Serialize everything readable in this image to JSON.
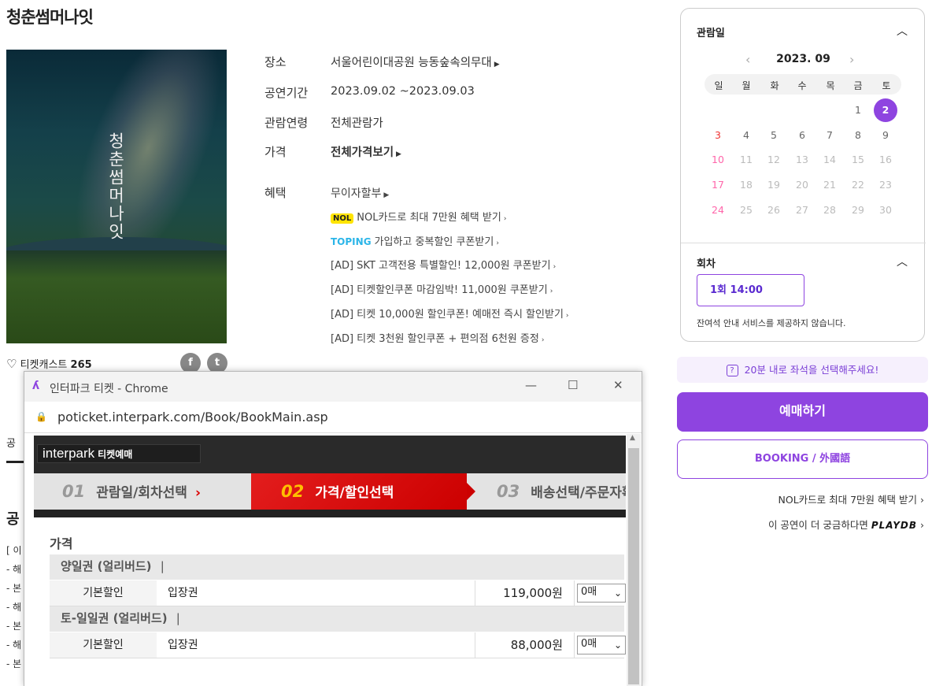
{
  "show": {
    "title": "청춘썸머나잇",
    "poster_text": "청춘썸머나잇"
  },
  "info": {
    "venue_label": "장소",
    "venue": "서울어린이대공원 능동숲속의무대",
    "period_label": "공연기간",
    "period": "2023.09.02 ~2023.09.03",
    "age_label": "관람연령",
    "age": "전체관람가",
    "price_label": "가격",
    "price": "전체가격보기",
    "benefit_label": "혜택"
  },
  "benefits": [
    "무이자할부",
    "NOL카드로 최대 7만원 혜택 받기",
    "가입하고 중복할인 쿠폰받기",
    "[AD] SKT 고객전용 특별할인! 12,000원 쿠폰받기",
    "[AD] 티켓할인쿠폰 마감임박! 11,000원 쿠폰받기",
    "[AD] 티켓 10,000원 할인쿠폰! 예매전 즉시 할인받기",
    "[AD] 티켓 3천원 할인쿠폰 + 편의점 6천원 증정"
  ],
  "badges": {
    "nol": "NOL",
    "toping": "TOPING"
  },
  "fav": {
    "label": "티켓캐스트",
    "count": "265"
  },
  "social": {
    "facebook": "f",
    "twitter": "t"
  },
  "calendar": {
    "heading": "관람일",
    "month": "2023. 09",
    "weekdays": [
      "일",
      "월",
      "화",
      "수",
      "목",
      "금",
      "토"
    ],
    "days": [
      "1",
      "2",
      "3",
      "4",
      "5",
      "6",
      "7",
      "8",
      "9",
      "10",
      "11",
      "12",
      "13",
      "14",
      "15",
      "16",
      "17",
      "18",
      "19",
      "20",
      "21",
      "22",
      "23",
      "24",
      "25",
      "26",
      "27",
      "28",
      "29",
      "30"
    ],
    "selected_day": "2"
  },
  "session": {
    "heading": "회차",
    "option": "1회 14:00",
    "notice": "잔여석 안내 서비스를 제공하지 않습니다."
  },
  "timer_notice": "20분 내로 좌석을 선택해주세요!",
  "reserve_button": "예매하기",
  "booking_button": "BOOKING / 外國語",
  "nol_link": "NOL카드로 최대 7만원 혜택 받기",
  "curious_link": "이 공연이 더 궁금하다면",
  "playdb": "PLAYDB",
  "background": {
    "tab_fragment": "공",
    "intro_fragment": "공",
    "bullets": [
      "[ 이",
      "- 해",
      "- 본",
      "- 해",
      "- 본",
      "- 해",
      "- 본"
    ]
  },
  "popup": {
    "window_title": "인터파크 티켓 - Chrome",
    "url": "poticket.interpark.com/Book/BookMain.asp",
    "brand": "interpark",
    "brand_sub": "티켓예매",
    "steps": [
      {
        "num": "01",
        "label": "관람일/회차선택"
      },
      {
        "num": "02",
        "label": "가격/할인선택"
      },
      {
        "num": "03",
        "label": "배송선택/주문자확인"
      }
    ],
    "price_heading": "가격",
    "groups": [
      {
        "name": "양일권 (얼리버드)",
        "row": {
          "discount": "기본할인",
          "type": "입장권",
          "price": "119,000원",
          "qty": "0매"
        }
      },
      {
        "name": "토-일일권 (얼리버드)",
        "row": {
          "discount": "기본할인",
          "type": "입장권",
          "price": "88,000원",
          "qty": "0매"
        }
      }
    ]
  }
}
